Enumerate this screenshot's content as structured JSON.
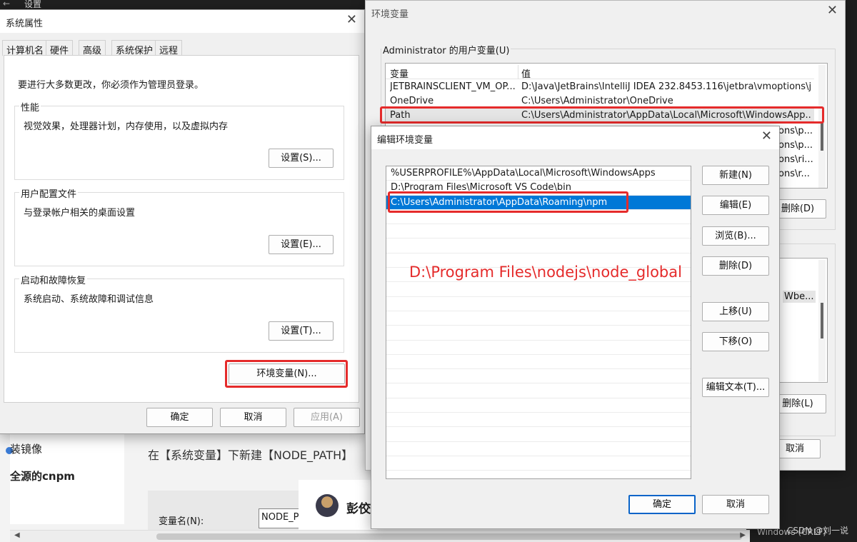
{
  "background": {
    "settings_title": "设置",
    "back_arrow": "←",
    "nav_items": [
      "装镜像",
      "全源的cnpm"
    ],
    "article_text": "在【系统变量】下新建【NODE_PATH】",
    "var_name_label": "变量名(N):",
    "var_name_value": "NODE_P",
    "author_name": "彭佼",
    "status_text": "Windows (CRLF)",
    "watermark": "CSDN @刘一说"
  },
  "system_properties": {
    "title": "系统属性",
    "close": "✕",
    "tabs": [
      "计算机名",
      "硬件",
      "高级",
      "系统保护",
      "远程"
    ],
    "active_tab": "高级",
    "admin_note": "要进行大多数更改，你必须作为管理员登录。",
    "groups": [
      {
        "title": "性能",
        "desc": "视觉效果，处理器计划，内存使用，以及虚拟内存",
        "button": "设置(S)..."
      },
      {
        "title": "用户配置文件",
        "desc": "与登录帐户相关的桌面设置",
        "button": "设置(E)..."
      },
      {
        "title": "启动和故障恢复",
        "desc": "系统启动、系统故障和调试信息",
        "button": "设置(T)..."
      }
    ],
    "env_button": "环境变量(N)...",
    "ok": "确定",
    "cancel": "取消",
    "apply": "应用(A)"
  },
  "environment_variables": {
    "title": "环境变量",
    "close": "✕",
    "user_group_title": "Administrator 的用户变量(U)",
    "columns": [
      "变量",
      "值"
    ],
    "rows": [
      {
        "name": "JETBRAINSCLIENT_VM_OP...",
        "value": "D:\\Java\\JetBrains\\IntelliJ IDEA 232.8453.116\\jetbra\\vmoptions\\j..."
      },
      {
        "name": "OneDrive",
        "value": "C:\\Users\\Administrator\\OneDrive"
      },
      {
        "name": "Path",
        "value": "C:\\Users\\Administrator\\AppData\\Local\\Microsoft\\WindowsApp..."
      }
    ],
    "peek_values": [
      "ons\\p...",
      "ons\\p...",
      "ons\\ri...",
      "ons\\r..."
    ],
    "user_delete_button": "删除(D)",
    "sys_peek_value": "Wbe...",
    "sys_delete_button": "删除(L)",
    "cancel": "取消"
  },
  "edit_env": {
    "title": "编辑环境变量",
    "close": "✕",
    "items": [
      "%USERPROFILE%\\AppData\\Local\\Microsoft\\WindowsApps",
      "D:\\Program Files\\Microsoft VS Code\\bin",
      "C:\\Users\\Administrator\\AppData\\Roaming\\npm"
    ],
    "selected_index": 2,
    "annotation": "D:\\Program Files\\nodejs\\node_global",
    "buttons": {
      "new": "新建(N)",
      "edit": "编辑(E)",
      "browse": "浏览(B)...",
      "delete": "删除(D)",
      "move_up": "上移(U)",
      "move_down": "下移(O)",
      "edit_text": "编辑文本(T)..."
    },
    "ok": "确定",
    "cancel": "取消",
    "highlight_color": "#e52b2b",
    "selection_color": "#0078d7"
  }
}
